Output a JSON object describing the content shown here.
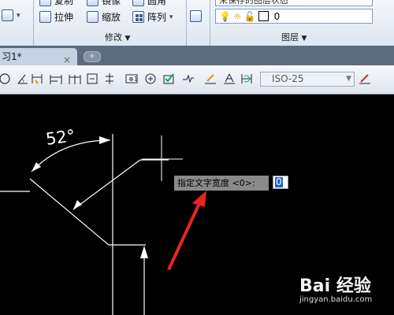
{
  "ribbon": {
    "left_items": [
      {
        "label": "复制",
        "icon": "copy-icon"
      },
      {
        "label": "镜像",
        "icon": "mirror-icon"
      },
      {
        "label": "圆角",
        "icon": "fillet-icon"
      }
    ],
    "row2": [
      {
        "label": "拉伸",
        "icon": "stretch-icon"
      },
      {
        "label": "缩放",
        "icon": "scale-icon"
      },
      {
        "label": "阵列",
        "icon": "array-icon"
      }
    ],
    "modify_panel": "修改",
    "layer_panel": "图层",
    "layer_state": "未保存的图层状态",
    "layer_current": "0"
  },
  "tabs": {
    "document": "习1*",
    "close": "×",
    "new": "+"
  },
  "dim_toolbar": {
    "style_value": "ISO-25"
  },
  "canvas": {
    "angle_text": "52°",
    "prompt_text": "指定文字宽度 <0>:",
    "input_value": "0",
    "accent_color": "#e8261c"
  },
  "watermark": {
    "logo": "Bai 经验",
    "url": "jingyan.baidu.com"
  }
}
